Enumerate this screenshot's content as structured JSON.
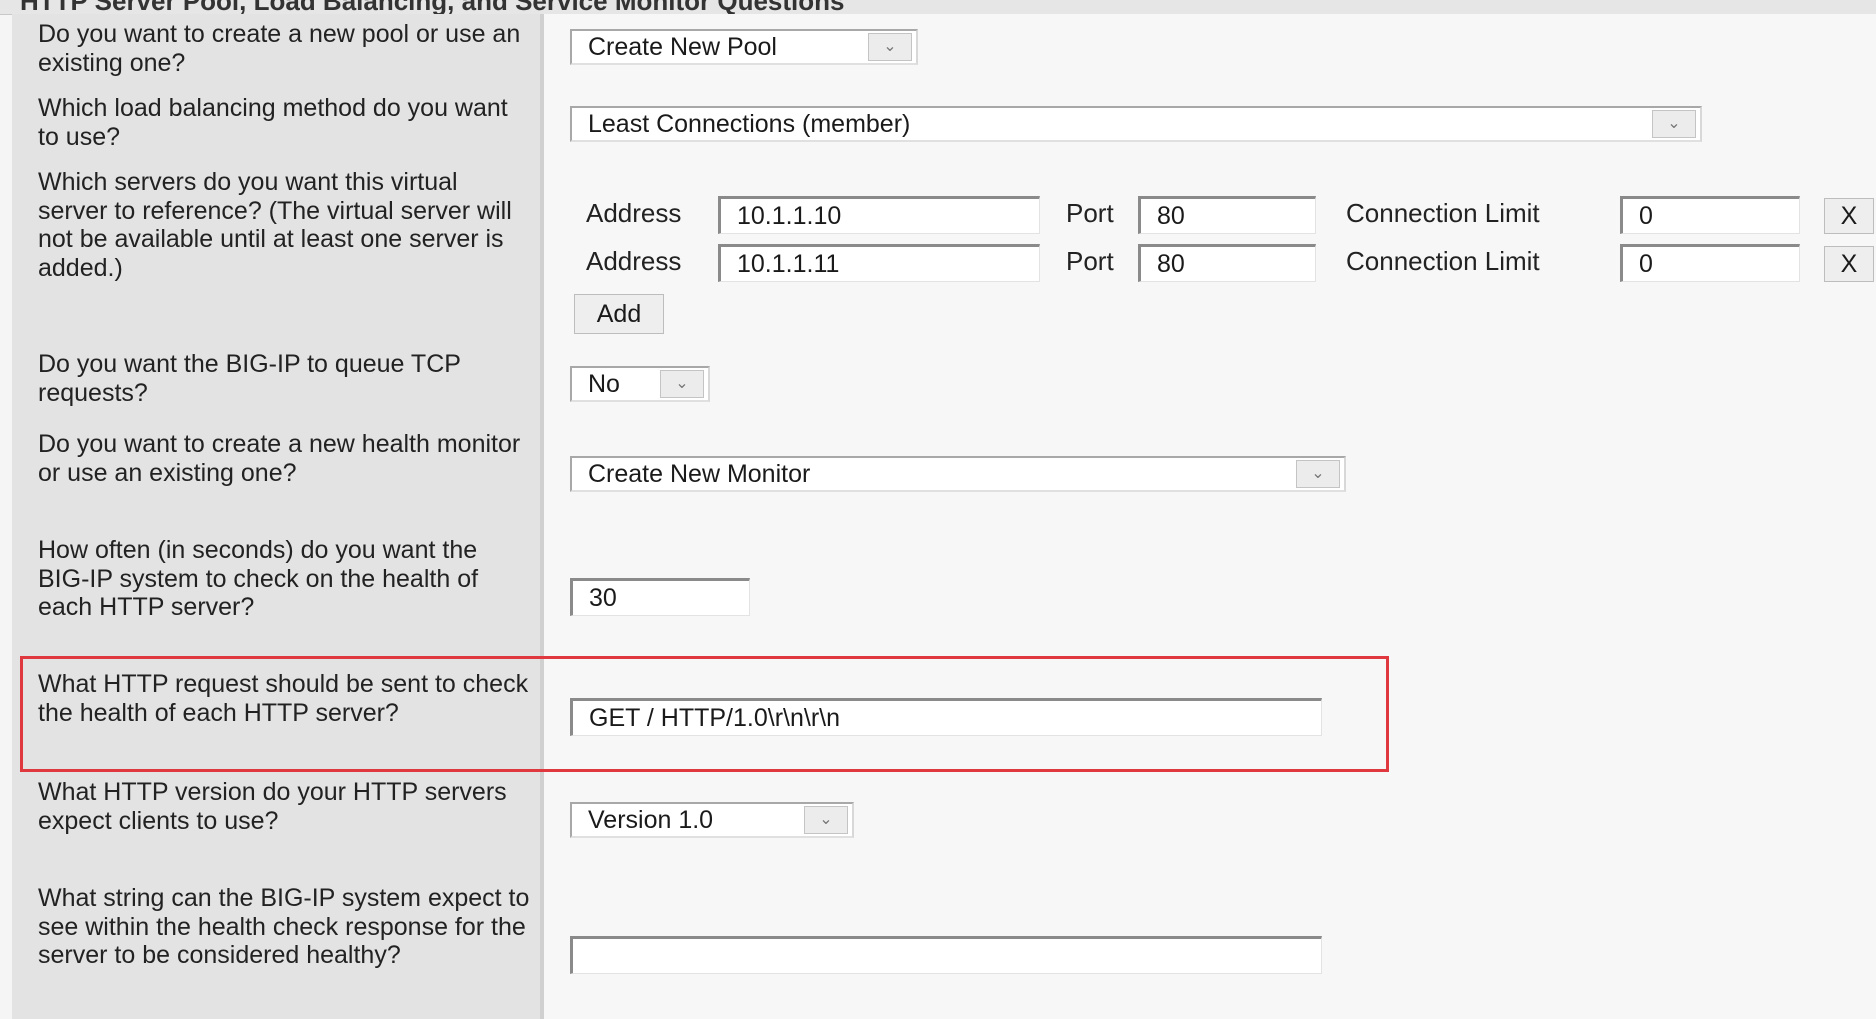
{
  "header": {
    "title": "HTTP Server Pool, Load Balancing, and Service Monitor Questions"
  },
  "q1": {
    "question": "Do you want to create a new pool or use an existing one?",
    "value": "Create New Pool"
  },
  "q2": {
    "question": "Which load balancing method do you want to use?",
    "value": "Least Connections (member)"
  },
  "q3": {
    "question": "Which servers do you want this virtual server to reference? (The virtual server will not be available until at least one server is added.)",
    "address_label": "Address",
    "port_label": "Port",
    "limit_label": "Connection Limit",
    "remove_label": "X",
    "servers": [
      {
        "address": "10.1.1.10",
        "port": "80",
        "limit": "0"
      },
      {
        "address": "10.1.1.11",
        "port": "80",
        "limit": "0"
      }
    ],
    "add_label": "Add"
  },
  "q4": {
    "question": "Do you want the BIG-IP to queue TCP requests?",
    "value": "No"
  },
  "q5": {
    "question": "Do you want to create a new health monitor or use an existing one?",
    "value": "Create New Monitor"
  },
  "q6": {
    "question": "How often (in seconds) do you want the BIG-IP system to check on the health of each HTTP server?",
    "value": "30"
  },
  "q7": {
    "question": "What HTTP request should be sent to check the health of each HTTP server?",
    "value": "GET / HTTP/1.0\\r\\n\\r\\n"
  },
  "q8": {
    "question": "What HTTP version do your HTTP servers expect clients to use?",
    "value": "Version 1.0"
  },
  "q9": {
    "question": "What string can the BIG-IP system expect to see within the health check response for the server to be considered healthy?",
    "value": ""
  },
  "colors": {
    "highlight": "#e0383f",
    "label_bg": "#e3e3e3",
    "field_bg": "#f7f7f7"
  },
  "icons": {
    "dropdown": "chevron-down-icon",
    "remove": "close-icon"
  }
}
